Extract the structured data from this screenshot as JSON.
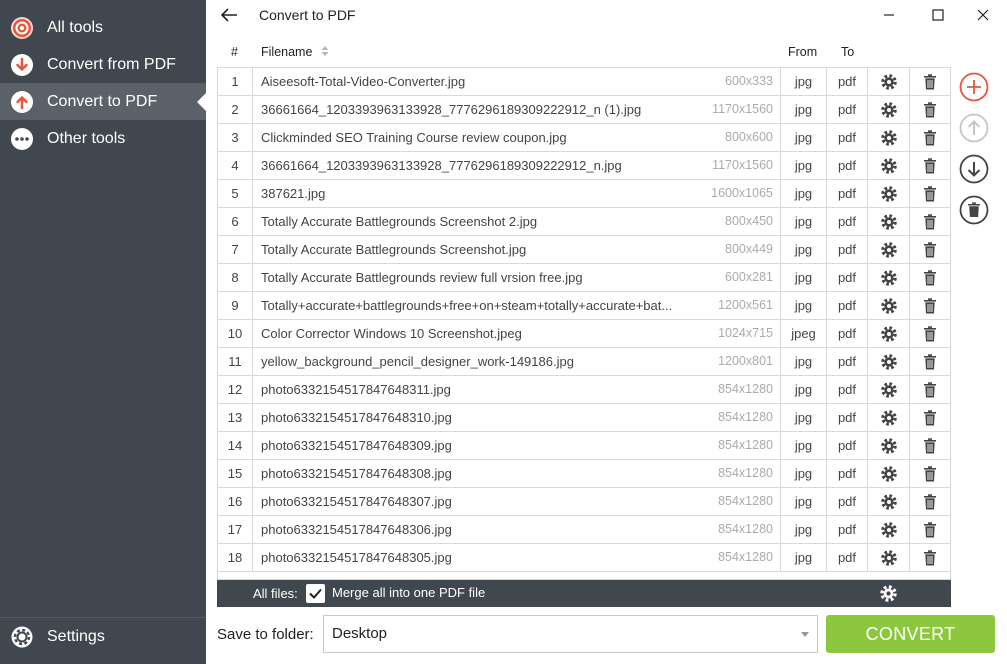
{
  "sidebar": {
    "items": [
      {
        "label": "All tools",
        "icon": "target-icon"
      },
      {
        "label": "Convert from PDF",
        "icon": "download-circle-icon"
      },
      {
        "label": "Convert to PDF",
        "icon": "upload-circle-icon"
      },
      {
        "label": "Other tools",
        "icon": "more-dots-icon"
      }
    ],
    "active_index": 2,
    "settings_label": "Settings"
  },
  "header": {
    "title": "Convert to PDF"
  },
  "table": {
    "columns": {
      "num": "#",
      "filename": "Filename",
      "from": "From",
      "to": "To"
    },
    "rows": [
      {
        "num": "1",
        "name": "Aiseesoft-Total-Video-Converter.jpg",
        "dim": "600x333",
        "from": "jpg",
        "to": "pdf"
      },
      {
        "num": "2",
        "name": "36661664_1203393963133928_7776296189309222912_n (1).jpg",
        "dim": "1170x1560",
        "from": "jpg",
        "to": "pdf"
      },
      {
        "num": "3",
        "name": "Clickminded SEO Training Course review coupon.jpg",
        "dim": "800x600",
        "from": "jpg",
        "to": "pdf"
      },
      {
        "num": "4",
        "name": "36661664_1203393963133928_7776296189309222912_n.jpg",
        "dim": "1170x1560",
        "from": "jpg",
        "to": "pdf"
      },
      {
        "num": "5",
        "name": "387621.jpg",
        "dim": "1600x1065",
        "from": "jpg",
        "to": "pdf"
      },
      {
        "num": "6",
        "name": "Totally Accurate Battlegrounds Screenshot 2.jpg",
        "dim": "800x450",
        "from": "jpg",
        "to": "pdf"
      },
      {
        "num": "7",
        "name": "Totally Accurate Battlegrounds Screenshot.jpg",
        "dim": "800x449",
        "from": "jpg",
        "to": "pdf"
      },
      {
        "num": "8",
        "name": "Totally Accurate Battlegrounds review full vrsion free.jpg",
        "dim": "600x281",
        "from": "jpg",
        "to": "pdf"
      },
      {
        "num": "9",
        "name": "Totally+accurate+battlegrounds+free+on+steam+totally+accurate+bat...",
        "dim": "1200x561",
        "from": "jpg",
        "to": "pdf"
      },
      {
        "num": "10",
        "name": "Color Corrector Windows 10 Screenshot.jpeg",
        "dim": "1024x715",
        "from": "jpeg",
        "to": "pdf"
      },
      {
        "num": "11",
        "name": "yellow_background_pencil_designer_work-149186.jpg",
        "dim": "1200x801",
        "from": "jpg",
        "to": "pdf"
      },
      {
        "num": "12",
        "name": "photo6332154517847648311.jpg",
        "dim": "854x1280",
        "from": "jpg",
        "to": "pdf"
      },
      {
        "num": "13",
        "name": "photo6332154517847648310.jpg",
        "dim": "854x1280",
        "from": "jpg",
        "to": "pdf"
      },
      {
        "num": "14",
        "name": "photo6332154517847648309.jpg",
        "dim": "854x1280",
        "from": "jpg",
        "to": "pdf"
      },
      {
        "num": "15",
        "name": "photo6332154517847648308.jpg",
        "dim": "854x1280",
        "from": "jpg",
        "to": "pdf"
      },
      {
        "num": "16",
        "name": "photo6332154517847648307.jpg",
        "dim": "854x1280",
        "from": "jpg",
        "to": "pdf"
      },
      {
        "num": "17",
        "name": "photo6332154517847648306.jpg",
        "dim": "854x1280",
        "from": "jpg",
        "to": "pdf"
      },
      {
        "num": "18",
        "name": "photo6332154517847648305.jpg",
        "dim": "854x1280",
        "from": "jpg",
        "to": "pdf"
      }
    ]
  },
  "side_actions": [
    "add-file-icon",
    "move-up-icon",
    "move-down-icon",
    "clear-all-icon"
  ],
  "all_files": {
    "label": "All files:",
    "merge_label": "Merge all into one PDF file",
    "merge_checked": true
  },
  "save": {
    "label": "Save to folder:",
    "folder": "Desktop"
  },
  "convert_label": "CONVERT",
  "colors": {
    "sidebar_bg": "#41474e",
    "sidebar_active": "#5b6168",
    "accent_red": "#e8553f",
    "convert_green": "#8dc63f"
  }
}
